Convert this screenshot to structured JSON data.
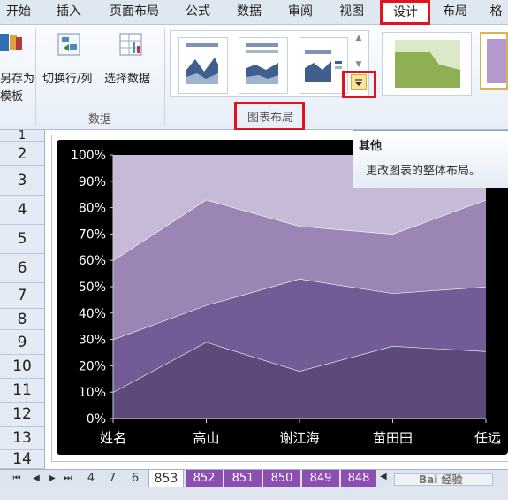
{
  "ribbon_tabs": [
    "开始",
    "插入",
    "页面布局",
    "公式",
    "数据",
    "审阅",
    "视图",
    "设计",
    "布局",
    "格"
  ],
  "ribbon": {
    "save_template_line1": "另存为",
    "save_template_line2": "模板",
    "switch_row_col": "切换行/列",
    "select_data": "选择数据",
    "data_group_label": "数据",
    "chart_layout_group_label": "图表布局"
  },
  "tooltip": {
    "title": "其他",
    "body": "更改图表的整体布局。"
  },
  "row_numbers": [
    "1",
    "2",
    "3",
    "4",
    "5",
    "6",
    "7",
    "8",
    "9",
    "10",
    "11",
    "12",
    "13",
    "14"
  ],
  "sheet_tabs": [
    "4",
    "7",
    "6",
    "853",
    "852",
    "851",
    "850",
    "849",
    "848"
  ],
  "active_sheet": "853",
  "watermark": "Bai 经验",
  "colors": {
    "accent_red": "#e0141e",
    "chart_bg": "#000000",
    "tab_purple": "#8a4fb0"
  },
  "chart_data": {
    "type": "area",
    "stacked": "percent",
    "categories": [
      "姓名",
      "高山",
      "谢江海",
      "苗田田",
      "任远"
    ],
    "y_ticks": [
      "0%",
      "10%",
      "20%",
      "30%",
      "40%",
      "50%",
      "60%",
      "70%",
      "80%",
      "90%",
      "100%"
    ],
    "ylim": [
      0,
      100
    ],
    "series_cumulative_boundaries": [
      [
        10,
        29,
        18,
        27.5,
        25.5
      ],
      [
        30,
        43,
        53,
        47.5,
        50
      ],
      [
        60,
        83,
        73,
        70,
        83
      ],
      [
        100,
        100,
        100,
        100,
        100
      ]
    ],
    "series_colors": [
      "#5e4a7a",
      "#735c96",
      "#9a85b4",
      "#c7bad6"
    ],
    "grid": false
  }
}
